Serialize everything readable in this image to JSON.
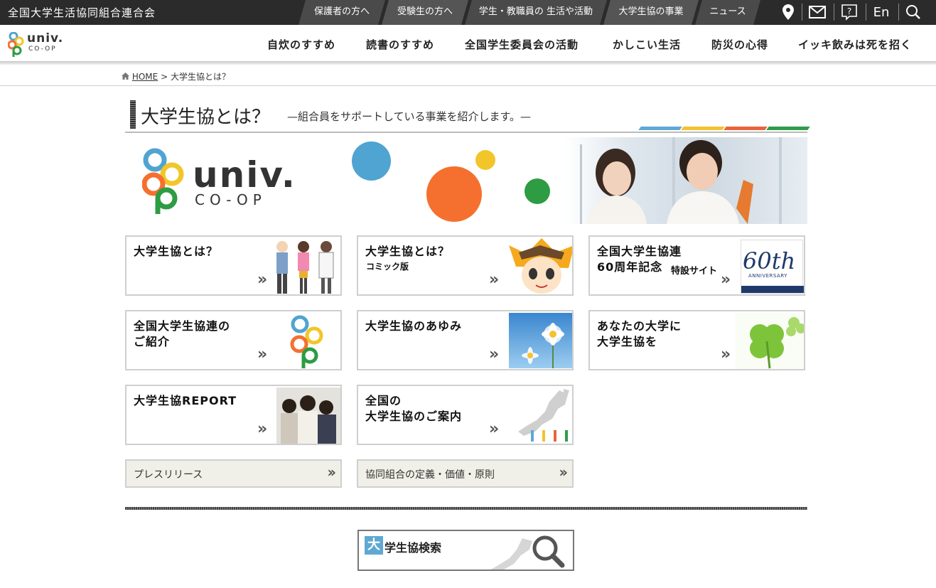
{
  "topbar": {
    "site_name": "全国大学生活協同組合連合会",
    "tabs": [
      "保護者の方へ",
      "受験生の方へ",
      "学生・教職員の 生活や活動",
      "大学生協の事業",
      "ニュース"
    ],
    "lang": "En"
  },
  "logo": {
    "main": "univ.",
    "sub": "CO-OP"
  },
  "nav": [
    "自炊のすすめ",
    "読書のすすめ",
    "全国学生委員会の活動",
    "かしこい生活",
    "防災の心得",
    "イッキ飲みは死を招く"
  ],
  "breadcrumb": {
    "home": "HOME",
    "sep": ">",
    "current": "大学生協とは？"
  },
  "page": {
    "title": "大学生協とは？",
    "subtitle": "—組合員をサポートしている事業を紹介します。—",
    "stripe_colors": [
      "#5fa8d3",
      "#f2c230",
      "#e8643a",
      "#2f9c49"
    ]
  },
  "hero": {
    "logo_main": "univ.",
    "logo_sub": "CO-OP",
    "circle_colors": [
      "#4fa4d1",
      "#f5702e",
      "#f2c62a",
      "#2d9c42"
    ]
  },
  "cards": [
    {
      "title_1": "大学生協とは？",
      "title_2": "",
      "sub": "",
      "thumb": "people-illustration"
    },
    {
      "title_1": "大学生協とは？",
      "title_2": "",
      "sub": "コミック版",
      "thumb": "comic-character"
    },
    {
      "title_1": "全国大学生協連",
      "title_2": "60周年記念",
      "sub": "特設サイト",
      "thumb": "60th-anniversary-logo",
      "thumb_text": "60th",
      "thumb_sub": "ANNIVERSARY"
    },
    {
      "title_1": "全国大学生協連の",
      "title_2": "ご紹介",
      "sub": "",
      "thumb": "coop-rings-logo"
    },
    {
      "title_1": "大学生協のあゆみ",
      "title_2": "",
      "sub": "",
      "thumb": "daisy-photo"
    },
    {
      "title_1": "あなたの大学に",
      "title_2": "大学生協を",
      "sub": "",
      "thumb": "clover-photo"
    },
    {
      "title_1": "大学生協REPORT",
      "title_2": "",
      "sub": "",
      "thumb": "students-photo"
    },
    {
      "title_1": "全国の",
      "title_2": "大学生協のご案内",
      "sub": "",
      "thumb": "japan-map"
    }
  ],
  "links": [
    "プレスリリース",
    "協同組合の定義・価値・原則"
  ],
  "search_box": {
    "big_char": "大",
    "rest": "学生協検索"
  }
}
